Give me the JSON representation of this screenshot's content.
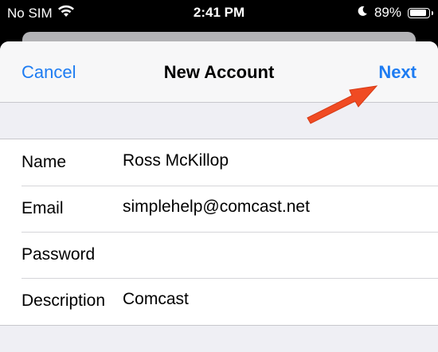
{
  "status_bar": {
    "carrier": "No SIM",
    "time": "2:41 PM",
    "battery": "89%",
    "battery_level": 0.89
  },
  "nav": {
    "cancel_label": "Cancel",
    "title": "New Account",
    "next_label": "Next"
  },
  "form": {
    "rows": [
      {
        "label": "Name",
        "value": "Ross McKillop"
      },
      {
        "label": "Email",
        "value": "simplehelp@comcast.net"
      },
      {
        "label": "Password",
        "value": ""
      },
      {
        "label": "Description",
        "value": "Comcast"
      }
    ]
  },
  "colors": {
    "accent": "#1e7cf2",
    "annotation_arrow": "#f04b23"
  },
  "icons": [
    "wifi-icon",
    "moon-icon",
    "battery-icon",
    "arrow-annotation-icon"
  ]
}
